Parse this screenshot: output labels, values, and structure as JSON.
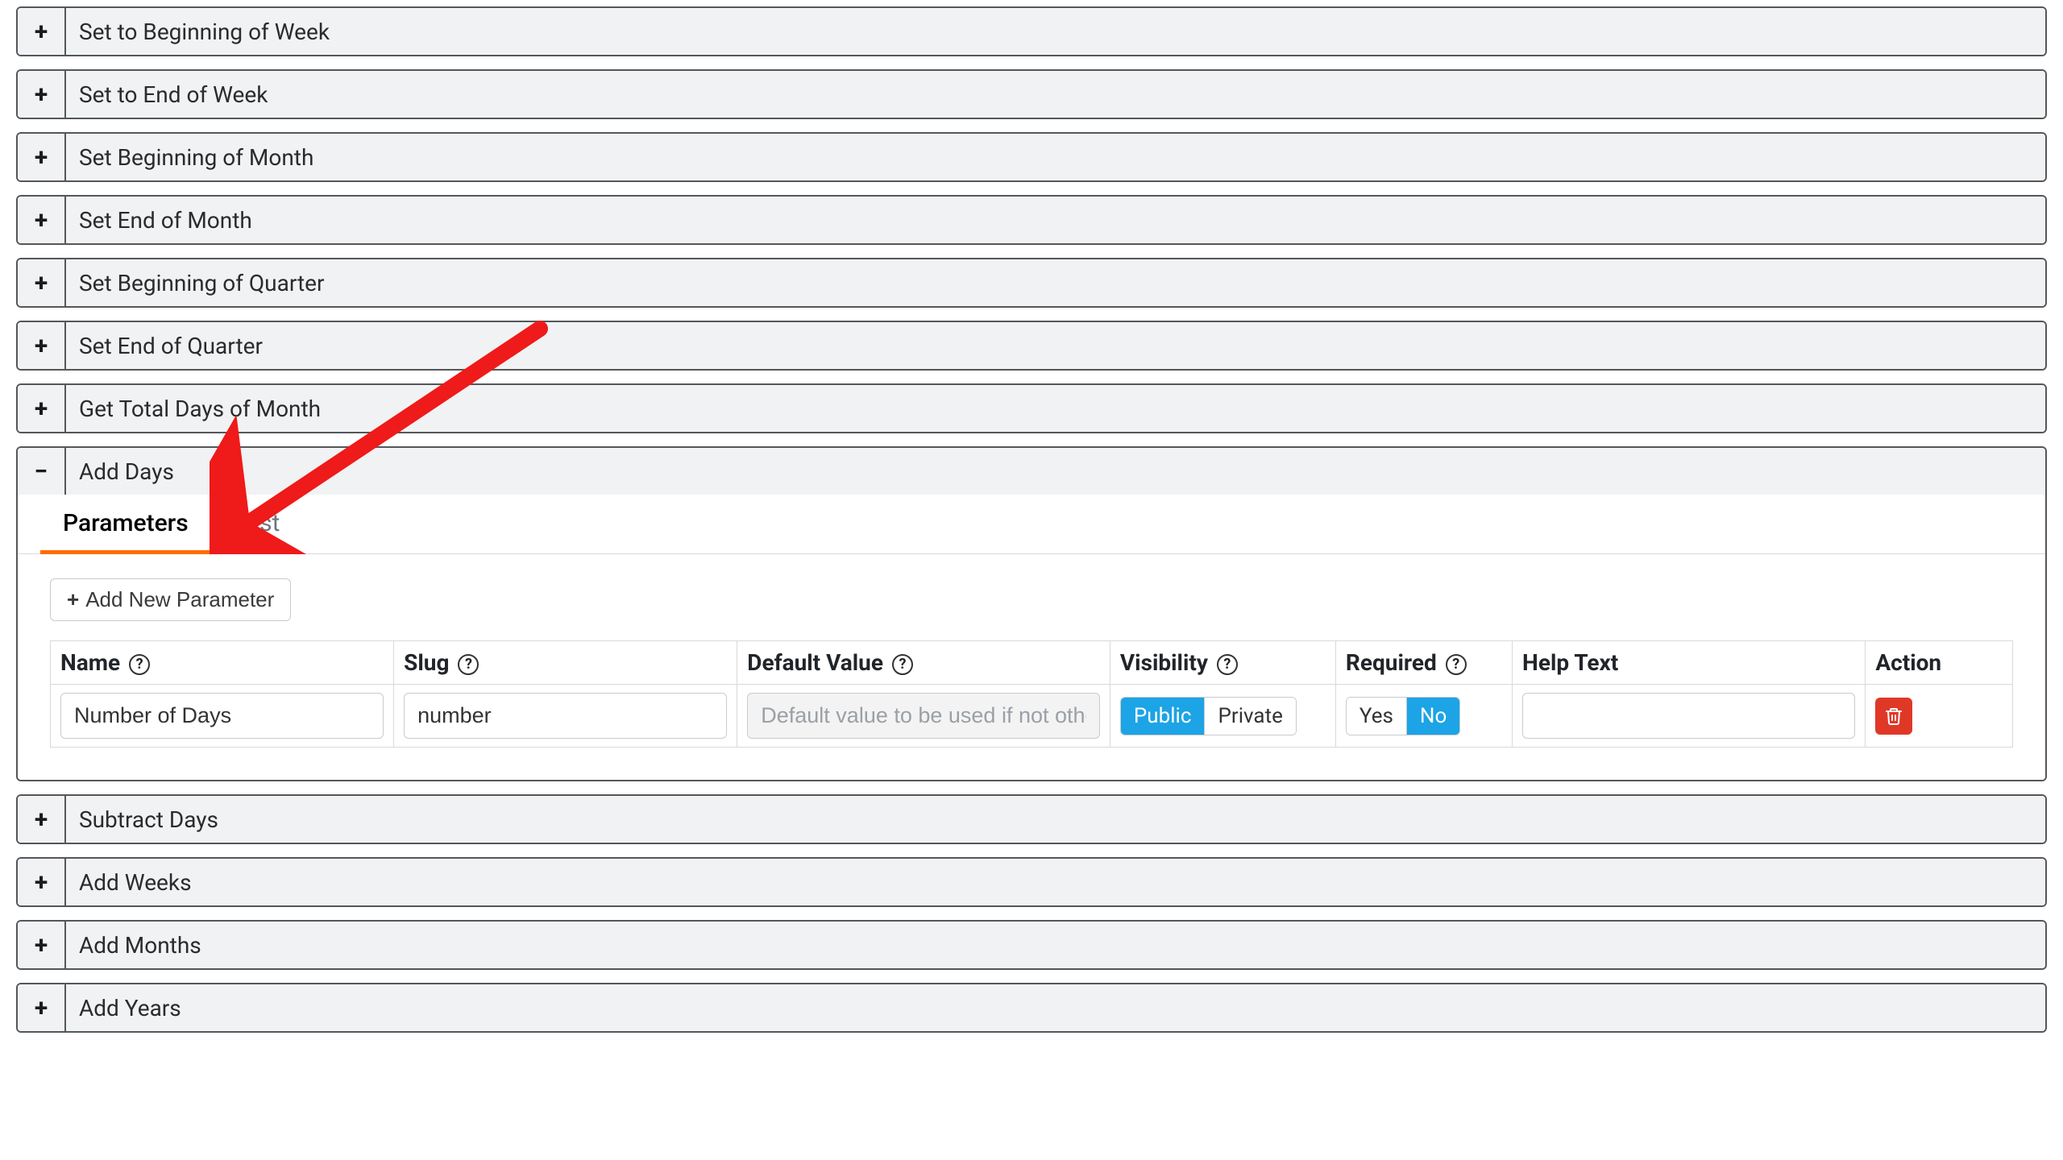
{
  "accordions_before": [
    {
      "title": "Set to Beginning of Week"
    },
    {
      "title": "Set to End of Week"
    },
    {
      "title": "Set Beginning of Month"
    },
    {
      "title": "Set End of Month"
    },
    {
      "title": "Set Beginning of Quarter"
    },
    {
      "title": "Set End of Quarter"
    },
    {
      "title": "Get Total Days of Month"
    }
  ],
  "expanded": {
    "title": "Add Days",
    "tabs": {
      "parameters": "Parameters",
      "test": "Test"
    },
    "add_param_button": "Add New Parameter",
    "headers": {
      "name": "Name",
      "slug": "Slug",
      "default_value": "Default Value",
      "visibility": "Visibility",
      "required": "Required",
      "help_text": "Help Text",
      "action": "Action"
    },
    "row": {
      "name_value": "Number of Days",
      "slug_value": "number",
      "default_placeholder": "Default value to be used if not otherv",
      "visibility": {
        "public": "Public",
        "private": "Private",
        "selected": "Public"
      },
      "required": {
        "yes": "Yes",
        "no": "No",
        "selected": "No"
      },
      "help_text_value": ""
    }
  },
  "accordions_after": [
    {
      "title": "Subtract Days"
    },
    {
      "title": "Add Weeks"
    },
    {
      "title": "Add Months"
    },
    {
      "title": "Add Years"
    }
  ],
  "icons": {
    "plus": "+",
    "minus": "−",
    "help": "?"
  }
}
